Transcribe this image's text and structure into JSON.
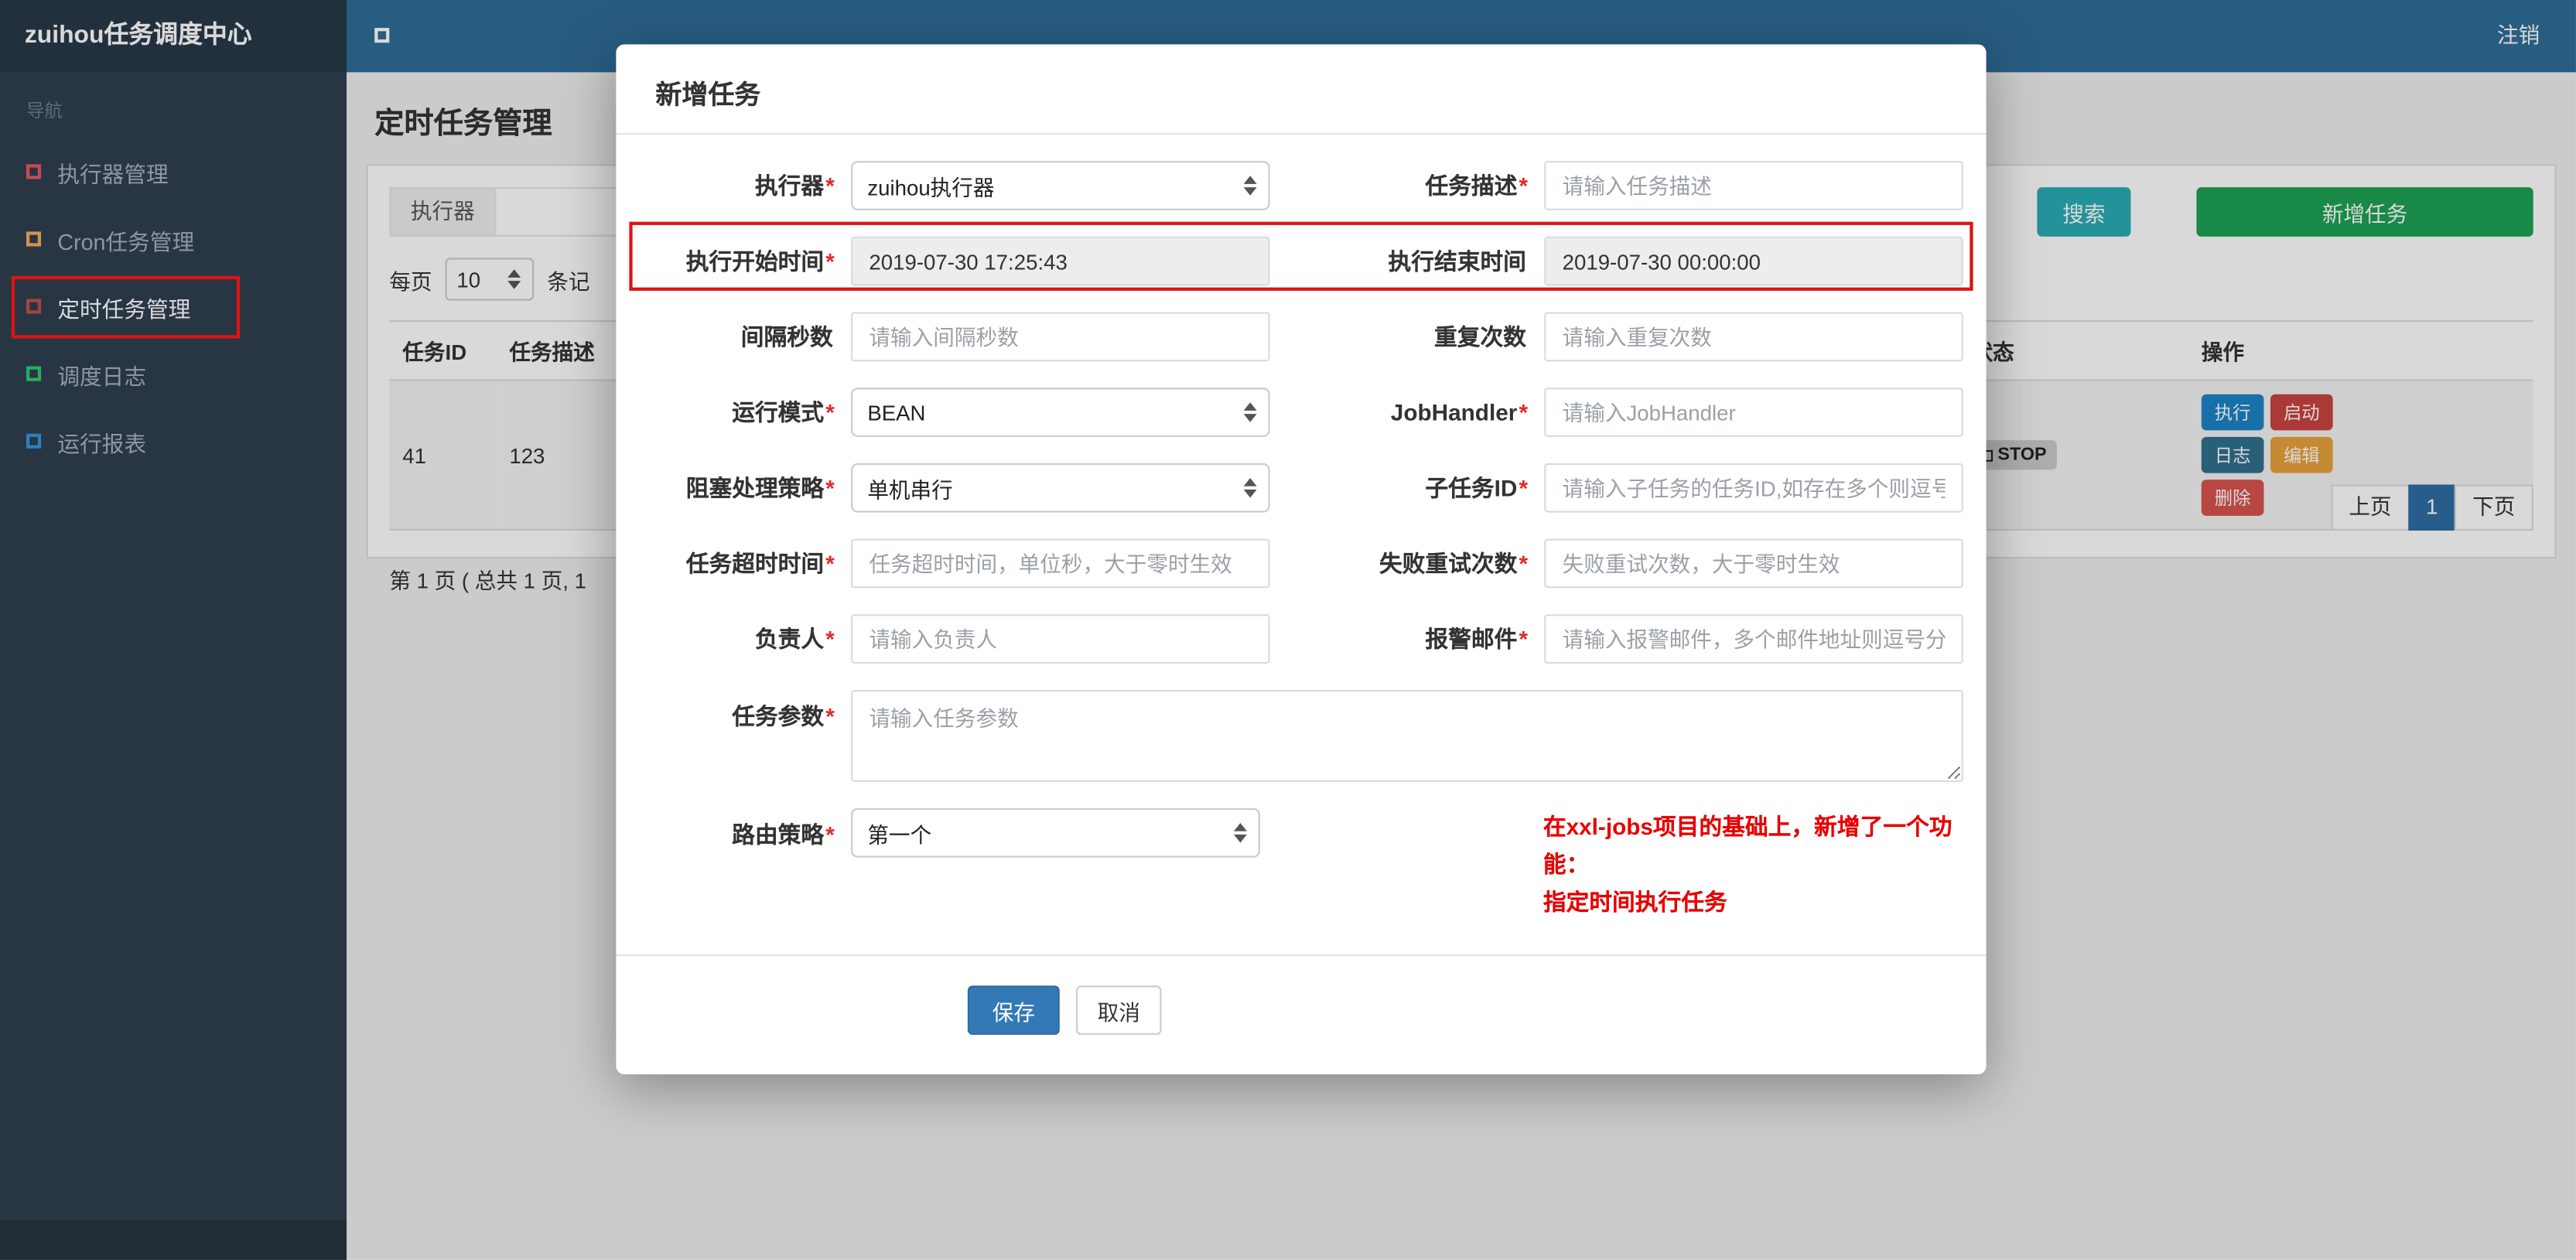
{
  "navbar": {
    "brand": "zuihou任务调度中心",
    "logout": "注销"
  },
  "sidebar": {
    "nav_label": "导航",
    "items": [
      {
        "label": "执行器管理",
        "color": "#ed5565"
      },
      {
        "label": "Cron任务管理",
        "color": "#f8ac59"
      },
      {
        "label": "定时任务管理",
        "color": "#c0504d"
      },
      {
        "label": "调度日志",
        "color": "#2ecc71"
      },
      {
        "label": "运行报表",
        "color": "#3498db"
      }
    ]
  },
  "page": {
    "title": "定时任务管理",
    "filter": {
      "executor_label": "执行器",
      "search_button": "搜索",
      "add_button": "新增任务"
    },
    "per_page": {
      "prefix": "每页",
      "value": "10",
      "suffix": "条记"
    },
    "table": {
      "headers": [
        "任务ID",
        "任务描述",
        "状态",
        "操作"
      ],
      "row": {
        "id": "41",
        "desc": "123",
        "status": "STOP",
        "actions": [
          {
            "label": "执行",
            "color": "#1c84c6"
          },
          {
            "label": "启动",
            "color": "#c9443f"
          },
          {
            "label": "日志",
            "color": "#31708f"
          },
          {
            "label": "编辑",
            "color": "#e8a33d"
          },
          {
            "label": "删除",
            "color": "#d9534f"
          }
        ]
      }
    },
    "summary": "第 1 页 ( 总共 1 页, 1",
    "pagination": {
      "prev": "上页",
      "current": "1",
      "next": "下页"
    }
  },
  "modal": {
    "title": "新增任务",
    "fields": [
      {
        "label": "执行器",
        "star": "*",
        "value": "zuihou执行器"
      },
      {
        "label": "任务描述",
        "star": "*",
        "placeholder": "请输入任务描述"
      },
      {
        "label": "执行开始时间",
        "star": "*",
        "value": "2019-07-30 17:25:43"
      },
      {
        "label": "执行结束时间",
        "star": "",
        "value": "2019-07-30 00:00:00"
      },
      {
        "label": "间隔秒数",
        "star": "",
        "placeholder": "请输入间隔秒数"
      },
      {
        "label": "重复次数",
        "star": "",
        "placeholder": "请输入重复次数"
      },
      {
        "label": "运行模式",
        "star": "*",
        "value": "BEAN"
      },
      {
        "label": "JobHandler",
        "star": "*",
        "placeholder": "请输入JobHandler"
      },
      {
        "label": "阻塞处理策略",
        "star": "*",
        "value": "单机串行"
      },
      {
        "label": "子任务ID",
        "star": "*",
        "placeholder": "请输入子任务的任务ID,如存在多个则逗号分隔"
      },
      {
        "label": "任务超时时间",
        "star": "*",
        "placeholder": "任务超时时间，单位秒，大于零时生效"
      },
      {
        "label": "失败重试次数",
        "star": "*",
        "placeholder": "失败重试次数，大于零时生效"
      },
      {
        "label": "负责人",
        "star": "*",
        "placeholder": "请输入负责人"
      },
      {
        "label": "报警邮件",
        "star": "*",
        "placeholder": "请输入报警邮件，多个邮件地址则逗号分隔"
      },
      {
        "label": "任务参数",
        "star": "*",
        "placeholder": "请输入任务参数"
      },
      {
        "label": "路由策略",
        "star": "*",
        "value": "第一个"
      }
    ],
    "note_line1": "在xxl-jobs项目的基础上，新增了一个功能：",
    "note_line2": "指定时间执行任务",
    "save_label": "保存",
    "cancel_label": "取消"
  },
  "colors": {
    "navbar": "#2f6e99",
    "brand_block": "#283949",
    "sidebar": "#2f4050",
    "search_button": "#2bacb5",
    "add_button": "#1da154",
    "save_button": "#3379b5",
    "pagination_active": "#2e6da4",
    "annotation": "#dd1414",
    "note_text": "#e60000"
  }
}
